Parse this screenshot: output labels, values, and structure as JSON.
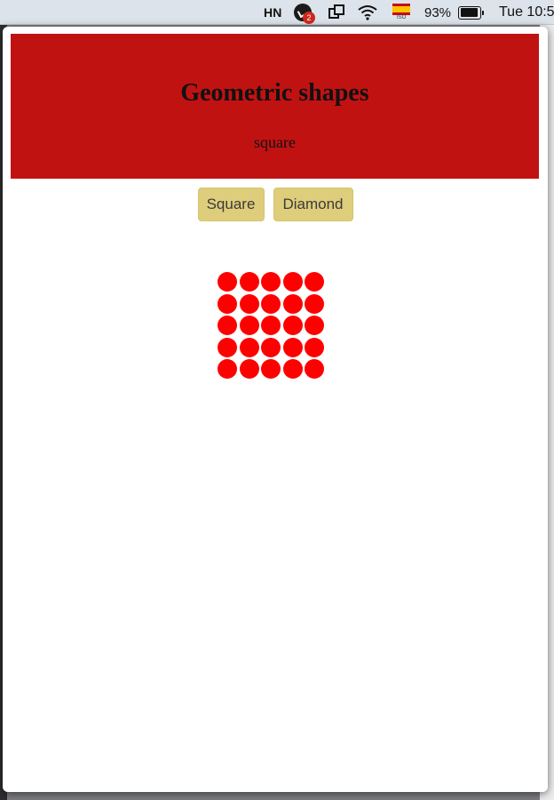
{
  "menubar": {
    "hn_label": "HN",
    "notification_count": "2",
    "flag_caption": "ISO",
    "battery_percent": "93%",
    "clock": "Tue 10:5",
    "battery_level": 0.93
  },
  "popup": {
    "title": "Geometric shapes",
    "current_shape": "square",
    "buttons": {
      "square_label": "Square",
      "diamond_label": "Diamond"
    },
    "shape": {
      "type": "square",
      "rows": 5,
      "cols": 5,
      "dot_color": "#ff0000"
    }
  },
  "colors": {
    "header_bg": "#c11212",
    "button_bg": "#decd7a"
  }
}
